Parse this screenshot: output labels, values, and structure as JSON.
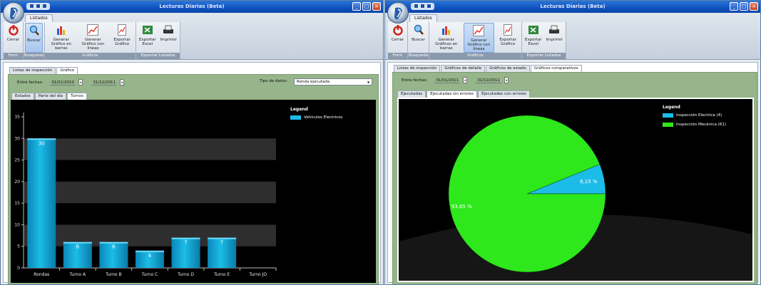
{
  "left": {
    "title": "Lecturas Diarias (Beta)",
    "ribbon_tab": "Listados",
    "groups": [
      {
        "label": "Form",
        "buttons": [
          "Cerrar"
        ]
      },
      {
        "label": "Busqueda",
        "buttons": [
          "Buscar"
        ]
      },
      {
        "label": "Gráficos",
        "buttons": [
          "Generar Gráfico en barras",
          "Generar Gráfico con líneas",
          "Exportar Gráfico"
        ]
      },
      {
        "label": "Exportar Listados",
        "buttons": [
          "Exportar Excel",
          "Imprimir"
        ]
      }
    ],
    "main_tabs": [
      "Listas de inspección",
      "Gráfico"
    ],
    "filter": {
      "label": "Entre fechas:",
      "from": "01/01/2010",
      "to": "31/12/2011",
      "type_label": "Tipo de datos:",
      "type_value": "Ronda ejecutada"
    },
    "sub_tabs": [
      "Estados",
      "Parte del día",
      "Turnos"
    ],
    "chart_data": {
      "type": "bar",
      "categories": [
        "Rondas",
        "Turno A",
        "Turno B",
        "Turno C",
        "Turno D",
        "Turno E",
        "Turno JO"
      ],
      "series": [
        {
          "name": "Vehículos Electricos",
          "values": [
            30,
            6,
            6,
            4,
            7,
            7,
            0
          ],
          "color": "#1bbde8"
        }
      ],
      "data_labels": [
        "30",
        "6",
        "6",
        "4",
        "7",
        "7",
        ""
      ],
      "yticks": [
        "0",
        "5",
        "10",
        "15",
        "20",
        "25",
        "30",
        "35"
      ],
      "ylim": [
        0,
        35
      ],
      "legend_title": "Legend",
      "legend_position": "top-right",
      "background": "#000000"
    }
  },
  "right": {
    "title": "Lecturas Diarias (Beta)",
    "ribbon_tab": "Listados",
    "groups": [
      {
        "label": "Form",
        "buttons": [
          "Cerrar"
        ]
      },
      {
        "label": "Busqueda",
        "buttons": [
          "Buscar"
        ]
      },
      {
        "label": "Gráficos",
        "buttons": [
          "Generar Gráficos en barras",
          "Generar Gráfico con líneas",
          "Exportar Gráfico"
        ]
      },
      {
        "label": "Exportar Listados",
        "buttons": [
          "Exportar Excel",
          "Imprimir"
        ]
      }
    ],
    "main_tabs": [
      "Listas de inspección",
      "Gráficos de detalle",
      "Gráficos de estado",
      "Gráficos comparativos"
    ],
    "filter": {
      "label": "Entre fechas:",
      "from": "01/01/2011",
      "to": "31/12/2011"
    },
    "sub_tabs": [
      "Ejecutadas",
      "Ejecutadas sin errores",
      "Ejecutadas con errores"
    ],
    "chart_data": {
      "type": "pie",
      "labels": [
        "Inspección Electrica (4)",
        "Inspección Mecánica (61)"
      ],
      "values": [
        4,
        61
      ],
      "slice_labels": [
        "6,15 %",
        "93,85 %"
      ],
      "colors": [
        "#1bbde8",
        "#2ee81c"
      ],
      "legend_title": "Legend",
      "legend_position": "top-right",
      "background": "#000000"
    }
  }
}
